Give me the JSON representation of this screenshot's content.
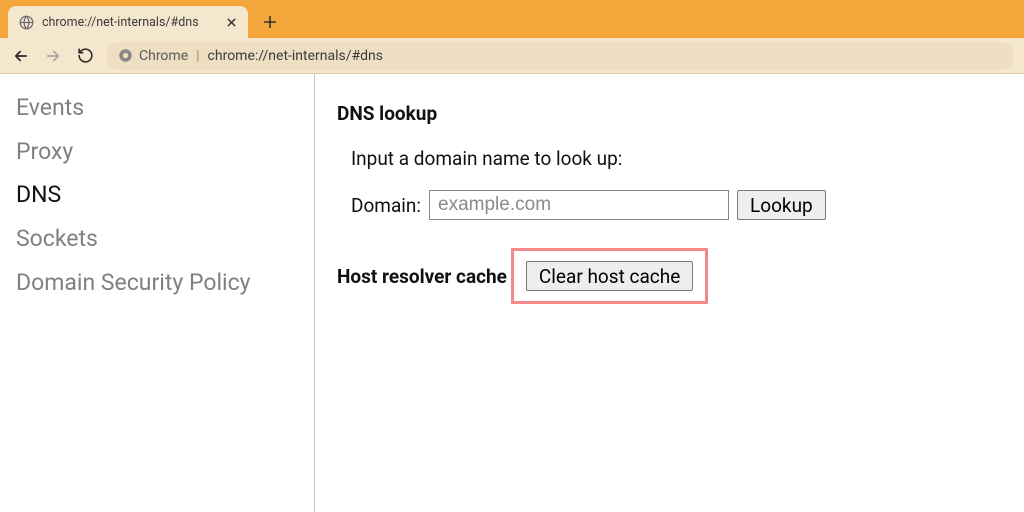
{
  "browser": {
    "tab_title": "chrome://net-internals/#dns",
    "omnibox_label": "Chrome",
    "omnibox_url": "chrome://net-internals/#dns"
  },
  "sidebar": {
    "items": [
      {
        "label": "Events",
        "active": false
      },
      {
        "label": "Proxy",
        "active": false
      },
      {
        "label": "DNS",
        "active": true
      },
      {
        "label": "Sockets",
        "active": false
      },
      {
        "label": "Domain Security Policy",
        "active": false
      }
    ]
  },
  "main": {
    "dns_lookup_title": "DNS lookup",
    "hint": "Input a domain name to look up:",
    "domain_label": "Domain:",
    "domain_placeholder": "example.com",
    "lookup_button": "Lookup",
    "resolver_title": "Host resolver cache",
    "clear_button": "Clear host cache"
  }
}
